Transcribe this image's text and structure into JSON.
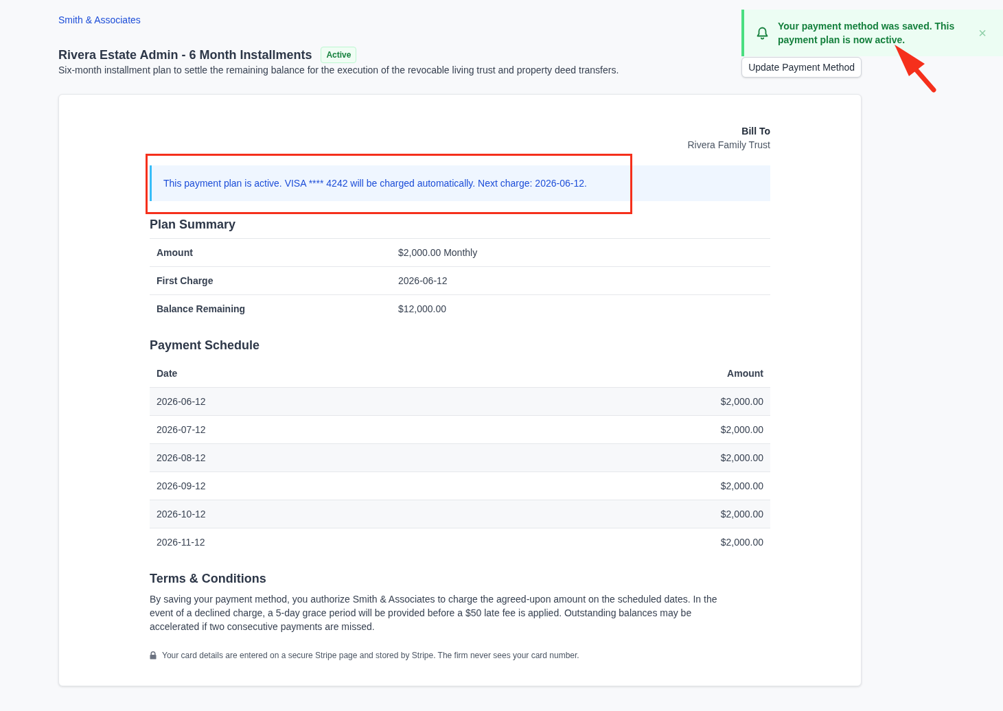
{
  "header": {
    "firm_link": "Smith & Associates",
    "title": "Rivera Estate Admin - 6 Month Installments",
    "status_badge": "Active",
    "description": "Six-month installment plan to settle the remaining balance for the execution of the revocable living trust and property deed transfers.",
    "action_button": "Update Payment Method"
  },
  "toast": {
    "message": "Your payment method was saved. This payment plan is now active.",
    "close": "×"
  },
  "bill_to": {
    "label": "Bill To",
    "name": "Rivera Family Trust"
  },
  "info_alert": "This payment plan is active. VISA **** 4242 will be charged automatically. Next charge: 2026-06-12.",
  "plan_summary": {
    "title": "Plan Summary",
    "rows": [
      {
        "label": "Amount",
        "value": "$2,000.00 Monthly"
      },
      {
        "label": "First Charge",
        "value": "2026-06-12"
      },
      {
        "label": "Balance Remaining",
        "value": "$12,000.00"
      }
    ]
  },
  "payment_schedule": {
    "title": "Payment Schedule",
    "columns": [
      "Date",
      "Amount"
    ],
    "rows": [
      {
        "date": "2026-06-12",
        "amount": "$2,000.00"
      },
      {
        "date": "2026-07-12",
        "amount": "$2,000.00"
      },
      {
        "date": "2026-08-12",
        "amount": "$2,000.00"
      },
      {
        "date": "2026-09-12",
        "amount": "$2,000.00"
      },
      {
        "date": "2026-10-12",
        "amount": "$2,000.00"
      },
      {
        "date": "2026-11-12",
        "amount": "$2,000.00"
      }
    ]
  },
  "terms": {
    "title": "Terms & Conditions",
    "body": "By saving your payment method, you authorize Smith & Associates to charge the agreed-upon amount on the scheduled dates. In the event of a declined charge, a 5-day grace period will be provided before a $50 late fee is applied. Outstanding balances may be accelerated if two consecutive payments are missed."
  },
  "security_note": "Your card details are entered on a secure Stripe page and stored by Stripe. The firm never sees your card number.",
  "annotation_marks": {
    "highlight_box": true,
    "arrow": true
  }
}
